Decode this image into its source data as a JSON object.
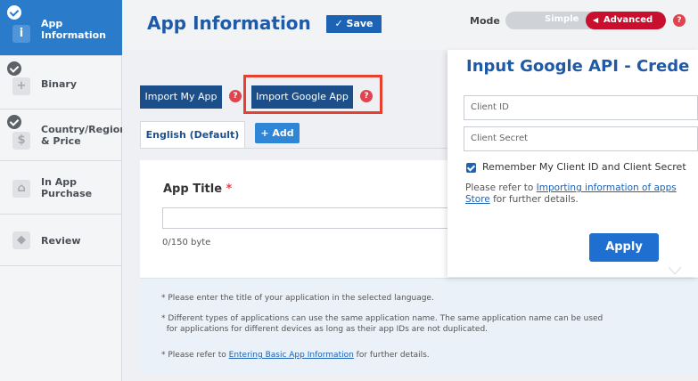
{
  "sidebar": {
    "items": [
      {
        "label_line1": "App",
        "label_line2": "Information",
        "icon": "info-icon",
        "active": true
      },
      {
        "label_line1": "Binary",
        "label_line2": "",
        "icon": "plus-icon",
        "active": false
      },
      {
        "label_line1": "Country/Region",
        "label_line2": "& Price",
        "icon": "dollar-icon",
        "active": false
      },
      {
        "label_line1": "In App",
        "label_line2": "Purchase",
        "icon": "cart-icon",
        "active": false
      },
      {
        "label_line1": "Review",
        "label_line2": "",
        "icon": "shield-icon",
        "active": false
      }
    ]
  },
  "header": {
    "title": "App Information",
    "save_label": "Save",
    "mode_label": "Mode",
    "mode_simple": "Simple",
    "mode_advanced": "Advanced",
    "mode_selected": "Advanced"
  },
  "toolbar": {
    "import_my_app": "Import My App",
    "import_google_app": "Import Google App"
  },
  "tabs": {
    "english": "English (Default)",
    "add": "+ Add"
  },
  "form": {
    "app_title_label": "App Title",
    "required_mark": "*",
    "title_value": "",
    "byte_count": "0/150 byte"
  },
  "notes": {
    "note1": "* Please enter the title of your application in the selected language.",
    "note2_line1": "* Different types of applications can use the same application name. The same application name can be used",
    "note2_line2": "for applications for different devices as long as their app IDs are not duplicated.",
    "note3_prefix": "* Please refer to ",
    "note3_link": "Entering Basic App Information",
    "note3_suffix": "  for further details."
  },
  "panel": {
    "title": "Input Google API - Crede",
    "client_id_placeholder": "Client ID",
    "client_secret_placeholder": "Client Secret",
    "remember_label": "Remember My Client ID and Client Secret",
    "remember_checked": true,
    "refer_prefix": "Please refer to ",
    "refer_link1": "Importing information of apps",
    "refer_link2": "Store",
    "refer_suffix": " for further details.",
    "apply_label": "Apply"
  },
  "colors": {
    "accent": "#2a7ccb",
    "title_blue": "#1f5aa6",
    "highlight_red": "#e8402e",
    "advanced_red": "#c8102e"
  }
}
